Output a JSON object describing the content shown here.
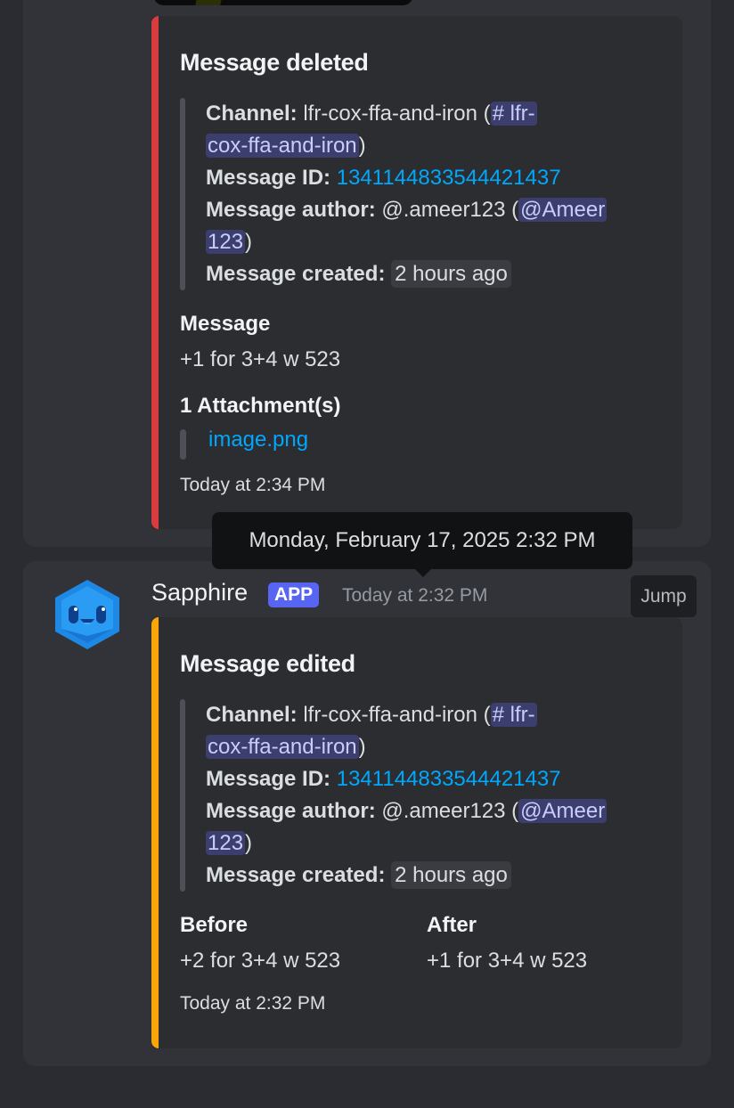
{
  "messages": [
    {
      "embed": {
        "color": "#d83c3e",
        "title": "Message deleted",
        "details": {
          "channel_label": "Channel:",
          "channel_name": "lfr-cox-ffa-and-iron (",
          "channel_mention_a": "# lfr-",
          "channel_mention_b": "cox-ffa-and-iron",
          "close_paren": ")",
          "message_id_label": "Message ID:",
          "message_id": "1341144833544421437",
          "author_label": "Message author:",
          "author_name": "@.ameer123 (",
          "author_mention_a": "@Ameer",
          "author_mention_b": "123",
          "created_label": "Message created:",
          "created_value": "2 hours ago"
        },
        "message_field_name": "Message",
        "message_field_value": "+1 for 3+4 w 523",
        "attachments_field_name": "1 Attachment(s)",
        "attachment_link": "image.png",
        "footer": "Today at 2:34 PM"
      }
    },
    {
      "author": "Sapphire",
      "badge": "APP",
      "timestamp": "Today at 2:32 PM",
      "tooltip": "Monday, February 17, 2025 2:32 PM",
      "jump_label": "Jump",
      "avatar_icon": "sapphire-gem-face-icon",
      "embed": {
        "color": "#f8a60a",
        "title": "Message edited",
        "details": {
          "channel_label": "Channel:",
          "channel_name": "lfr-cox-ffa-and-iron (",
          "channel_mention_a": "# lfr-",
          "channel_mention_b": "cox-ffa-and-iron",
          "close_paren": ")",
          "message_id_label": "Message ID:",
          "message_id": "1341144833544421437",
          "author_label": "Message author:",
          "author_name": "@.ameer123 (",
          "author_mention_a": "@Ameer",
          "author_mention_b": "123",
          "created_label": "Message created:",
          "created_value": "2 hours ago"
        },
        "before_name": "Before",
        "before_value": "+2 for 3+4 w 523",
        "after_name": "After",
        "after_value": "+1 for 3+4 w 523",
        "footer": "Today at 2:32 PM"
      }
    }
  ]
}
